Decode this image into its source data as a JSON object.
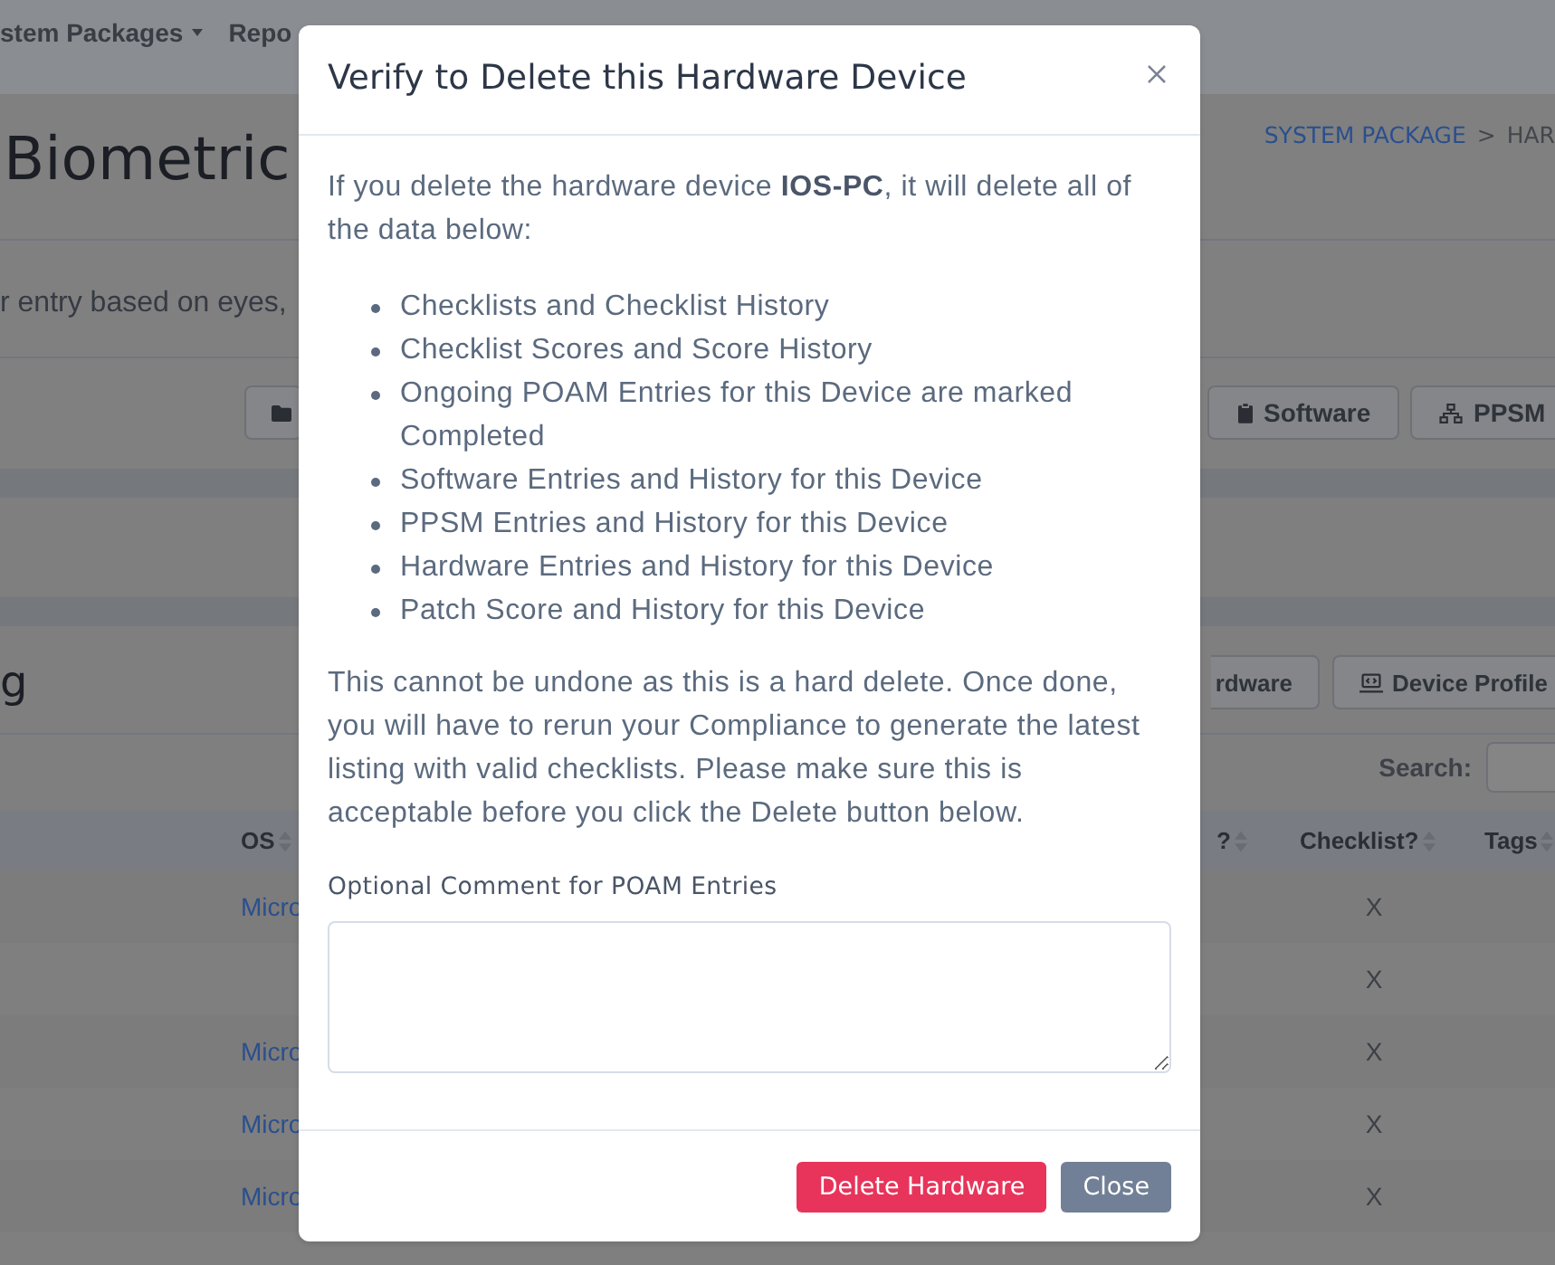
{
  "nav": {
    "items": [
      {
        "label": "stem Packages",
        "dropdown": true
      },
      {
        "label": "Repo"
      }
    ]
  },
  "page_header": {
    "title": "Biometric",
    "breadcrumb": {
      "items": [
        {
          "label": "SYSTEM PACKAGE",
          "link": true
        },
        {
          "label": "HAR",
          "link": false
        }
      ],
      "separator": ">"
    },
    "description": "r entry based on eyes,"
  },
  "toolbar": {
    "buttons": [
      {
        "kind": "icon_only"
      },
      {
        "kind": "labeled",
        "label": "Software"
      },
      {
        "kind": "labeled",
        "label": "PPSM"
      }
    ]
  },
  "hardware_card": {
    "title": "g",
    "buttons": [
      {
        "label": "rdware"
      },
      {
        "label": "Device Profile"
      }
    ],
    "search": {
      "label": "Search:"
    },
    "columns": [
      {
        "label": "OS"
      },
      {
        "label": "?"
      },
      {
        "label": "Checklist?"
      },
      {
        "label": "Tags"
      }
    ],
    "rows": [
      {
        "os": "Micro",
        "checklist": "X"
      },
      {
        "checklist": "X"
      },
      {
        "os": "Micro",
        "checklist": "X"
      },
      {
        "os": "Micro",
        "checklist": "X"
      },
      {
        "os": "Micro",
        "checklist": "X"
      }
    ]
  },
  "modal": {
    "title": "Verify to Delete this Hardware Device",
    "intro": "If you delete the hardware device **IOS-PC**, it will delete all of the data below:",
    "items": [
      "Checklists and Checklist History",
      "Checklist Scores and Score History",
      "Ongoing POAM Entries for this Device are marked Completed",
      "Software Entries and History for this Device",
      "PPSM Entries and History for this Device",
      "Hardware Entries and History for this Device",
      "Patch Score and History for this Device"
    ],
    "warning": "This cannot be undone as this is a hard delete. Once done, you will have to rerun your Compliance to generate the latest listing with valid checklists. Please make sure this is acceptable before you click the Delete button below.",
    "comment": {
      "label": "Optional Comment for POAM Entries"
    },
    "buttons": [
      {
        "label": "Delete Hardware",
        "kind": "danger"
      },
      {
        "label": "Close",
        "kind": "secondary"
      }
    ]
  }
}
